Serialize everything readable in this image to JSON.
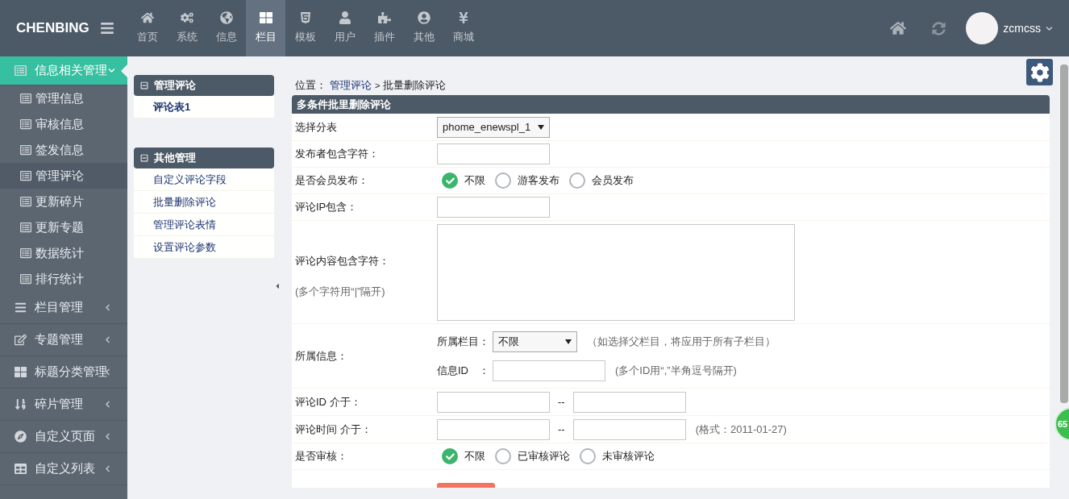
{
  "header": {
    "brand": "CHENBING",
    "nav": [
      {
        "label": "首页",
        "selected": false
      },
      {
        "label": "系统",
        "selected": false
      },
      {
        "label": "信息",
        "selected": false
      },
      {
        "label": "栏目",
        "selected": true
      },
      {
        "label": "模板",
        "selected": false
      },
      {
        "label": "用户",
        "selected": false
      },
      {
        "label": "插件",
        "selected": false
      },
      {
        "label": "其他",
        "selected": false
      },
      {
        "label": "商城",
        "selected": false
      }
    ],
    "user": "zcmcss"
  },
  "sidebar": {
    "groups": [
      {
        "label": "信息相关管理",
        "expanded": true,
        "children": [
          {
            "label": "管理信息",
            "selected": false
          },
          {
            "label": "审核信息",
            "selected": false
          },
          {
            "label": "签发信息",
            "selected": false
          },
          {
            "label": "管理评论",
            "selected": true
          },
          {
            "label": "更新碎片",
            "selected": false
          },
          {
            "label": "更新专题",
            "selected": false
          },
          {
            "label": "数据统计",
            "selected": false
          },
          {
            "label": "排行统计",
            "selected": false
          }
        ]
      },
      {
        "label": "栏目管理",
        "expanded": false
      },
      {
        "label": "专题管理",
        "expanded": false
      },
      {
        "label": "标题分类管理",
        "expanded": false
      },
      {
        "label": "碎片管理",
        "expanded": false
      },
      {
        "label": "自定义页面",
        "expanded": false
      },
      {
        "label": "自定义列表",
        "expanded": false
      }
    ]
  },
  "subpanel": [
    {
      "title": "管理评论",
      "items": [
        {
          "label": "评论表1",
          "selected": true
        }
      ]
    },
    {
      "title": "其他管理",
      "items": [
        {
          "label": "自定义评论字段",
          "selected": false
        },
        {
          "label": "批量删除评论",
          "selected": false
        },
        {
          "label": "管理评论表情",
          "selected": false
        },
        {
          "label": "设置评论参数",
          "selected": false
        }
      ]
    }
  ],
  "breadcrumb": {
    "prefix": "位置：",
    "link": "管理评论",
    "separator": ">",
    "current": "批量删除评论"
  },
  "form": {
    "title": "多条件批里删除评论",
    "rows": [
      {
        "kind": "select",
        "label": "选择分表",
        "value": "phome_enewspl_1"
      },
      {
        "kind": "text",
        "label": "发布者包含字符："
      },
      {
        "kind": "radios",
        "label": "是否会员发布：",
        "options": [
          {
            "label": "不限",
            "selected": true
          },
          {
            "label": "游客发布",
            "selected": false
          },
          {
            "label": "会员发布",
            "selected": false
          }
        ]
      },
      {
        "kind": "text",
        "label": "评论IP包含："
      },
      {
        "kind": "textarea",
        "label": "评论内容包含字符：",
        "hint": "(多个字符用“|”隔开)"
      },
      {
        "kind": "group",
        "label": "所属信息：",
        "lines": [
          {
            "kind": "select",
            "label": "所属栏目：",
            "value": "不限",
            "hint": "（如选择父栏目，将应用于所有子栏目）"
          },
          {
            "kind": "text",
            "label": "信息ID　：",
            "hint": "(多个ID用“,”半角逗号隔开)"
          }
        ]
      },
      {
        "kind": "range",
        "label": "评论ID 介于：",
        "separator": "--"
      },
      {
        "kind": "range",
        "label": "评论时间 介于：",
        "separator": "--",
        "hint": "(格式：2011-01-27)"
      },
      {
        "kind": "radios",
        "label": "是否审核：",
        "options": [
          {
            "label": "不限",
            "selected": true
          },
          {
            "label": "已审核评论",
            "selected": false
          },
          {
            "label": "未审核评论",
            "selected": false
          }
        ]
      },
      {
        "kind": "submit"
      }
    ]
  },
  "badge": "65"
}
